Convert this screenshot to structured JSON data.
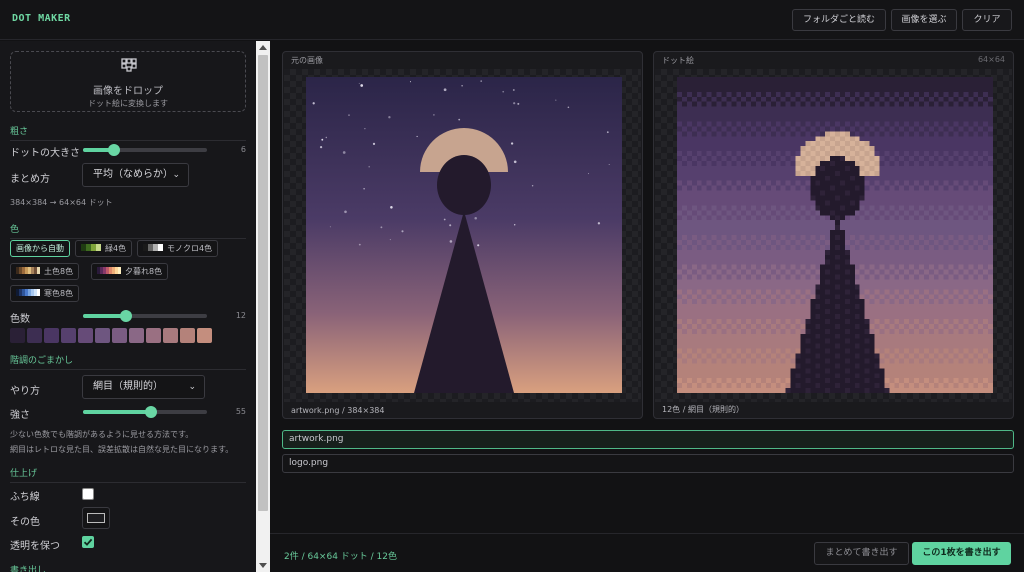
{
  "app": {
    "title": "DOT MAKER"
  },
  "header": {
    "buttons": [
      {
        "label": "フォルダごと読む"
      },
      {
        "label": "画像を選ぶ"
      },
      {
        "label": "クリア"
      }
    ]
  },
  "sidebar": {
    "drop": {
      "title": "画像をドロップ",
      "subtitle": "ドット絵に変換します",
      "icon": "grid-dots-icon"
    },
    "coarseness": {
      "heading": "粗さ",
      "dot_size": {
        "label": "ドットの大きさ",
        "value": "6",
        "fraction": 0.25
      },
      "method": {
        "label": "まとめ方",
        "value": "平均（なめらか）"
      },
      "note": "384×384 → 64×64 ドット"
    },
    "color": {
      "heading": "色",
      "presets": [
        {
          "label": "画像から自動",
          "active": true,
          "swatch": []
        },
        {
          "label": "緑4色",
          "active": false,
          "swatch": [
            "#1f3b12",
            "#3f6b20",
            "#7fa33a",
            "#c7d98a"
          ]
        },
        {
          "label": "モノクロ4色",
          "active": false,
          "swatch": [
            "#1a1a1a",
            "#666666",
            "#b0b0b0",
            "#ffffff"
          ]
        },
        {
          "label": "土色8色",
          "active": false,
          "swatch": [
            "#3b2a1c",
            "#6b4a2a",
            "#9c6b3c",
            "#c79a5a",
            "#e0c080",
            "#a8825a",
            "#705038",
            "#e8d8b0"
          ]
        },
        {
          "label": "夕暮れ8色",
          "active": false,
          "swatch": [
            "#2a1a3a",
            "#5a2a5a",
            "#8a3a6a",
            "#c05a6a",
            "#e08a6a",
            "#f0b07a",
            "#ffd89a",
            "#fff0c0"
          ]
        },
        {
          "label": "寒色8色",
          "active": false,
          "swatch": [
            "#0f1a33",
            "#1f3566",
            "#2f5599",
            "#4a7acc",
            "#7aa6e0",
            "#a8c8f0",
            "#d0e4fa",
            "#ffffff"
          ]
        }
      ],
      "count": {
        "label": "色数",
        "value": "12",
        "fraction": 0.35
      },
      "palette": [
        "#2a2036",
        "#3d2e52",
        "#4a3663",
        "#56406e",
        "#664b78",
        "#6e5680",
        "#7a5c82",
        "#8a6886",
        "#9a7082",
        "#a87a7e",
        "#b4827a",
        "#c48e7e"
      ]
    },
    "dither": {
      "heading": "階調のごまかし",
      "method": {
        "label": "やり方",
        "value": "網目（規則的）"
      },
      "strength": {
        "label": "強さ",
        "value": "55",
        "fraction": 0.55
      },
      "note1": "少ない色数でも階調があるように見せる方法です。",
      "note2": "網目はレトロな見た目、誤差拡散は自然な見た目になります。"
    },
    "finish": {
      "heading": "仕上げ",
      "outline": {
        "label": "ふち線",
        "checked": false
      },
      "outline_color": {
        "label": "その色",
        "value": "#1d1d20"
      },
      "keep_alpha": {
        "label": "透明を保つ",
        "checked": true
      }
    },
    "export_heading": "書き出し"
  },
  "main": {
    "original": {
      "title": "元の画像",
      "footer": "artwork.png / 384×384"
    },
    "dot": {
      "title": "ドット絵",
      "size": "64×64",
      "footer": "12色 / 網目（規則的）"
    },
    "files": [
      {
        "name": "artwork.png",
        "selected": true
      },
      {
        "name": "logo.png",
        "selected": false
      }
    ]
  },
  "footer": {
    "status": "2件 / 64×64 ドット / 12色",
    "export_all": "まとめて書き出す",
    "export_one": "この1枚を書き出す"
  },
  "colors": {
    "accent": "#5fd3a0",
    "sky_top": "#2b2548",
    "sky_bottom": "#d9a07f",
    "moon": "#c7a48f"
  }
}
